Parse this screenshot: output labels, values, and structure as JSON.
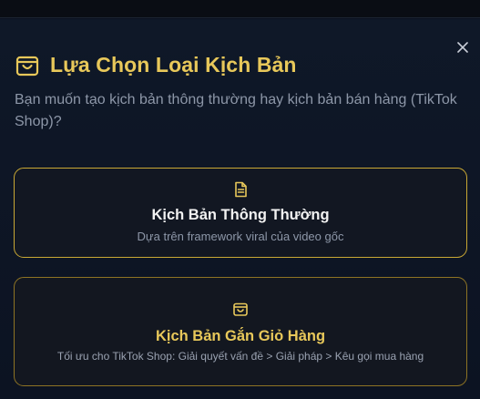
{
  "dialog": {
    "title": "Lựa Chọn Loại Kịch Bản",
    "subtitle": "Bạn muốn tạo kịch bản thông thường hay kịch bản bán hàng (TikTok Shop)?",
    "title_icon": "shopping-bag-icon",
    "close_icon": "close-icon"
  },
  "options": [
    {
      "icon": "document-icon",
      "title": "Kịch Bản Thông Thường",
      "description": "Dựa trên framework viral của video gốc"
    },
    {
      "icon": "shopping-bag-icon",
      "title": "Kịch Bản Gắn Giỏ Hàng",
      "description": "Tối ưu cho TikTok Shop: Giải quyết vấn đề > Giải pháp > Kêu gọi mua hàng"
    }
  ],
  "colors": {
    "accent": "#e8c85a",
    "background": "#0f1828",
    "card_border": "#c9a834"
  }
}
